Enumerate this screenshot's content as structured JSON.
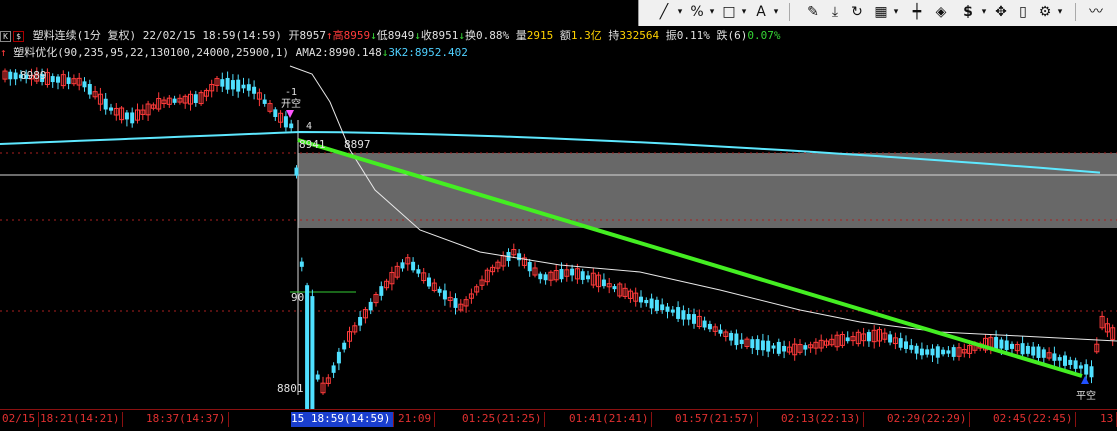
{
  "toolbar": {
    "tools": [
      "line-tool-icon",
      "percent-tool-icon",
      "rect-tool-icon",
      "text-tool-icon",
      "pencil-icon",
      "download-icon",
      "refresh-icon",
      "grid-icon",
      "candle-settings-icon",
      "diamond-icon",
      "dollar-icon",
      "move-icon",
      "bar-icon",
      "gear-icon",
      "line-chart-icon"
    ],
    "labels": {
      "percent": "%",
      "text": "A",
      "dollar": "$"
    }
  },
  "header": {
    "k_badge": "K",
    "s_badge": "$",
    "title": "塑料连续(1分 复权)",
    "datetime": "22/02/15 18:59(14:59)",
    "open": "开8957",
    "high": "高8959",
    "low": "低8949",
    "close": "收8951",
    "turnover": "换0.88%",
    "volume_label": "量",
    "volume": "2915",
    "amount_label": "额",
    "amount": "1.3亿",
    "hold_label": "持",
    "hold": "332564",
    "amplitude": "振0.11%",
    "change_label": "跌(6)",
    "change": "0.07%"
  },
  "indicator": {
    "name": "塑料优化(90,235,95,22,130100,24000,25900,1)",
    "ama2": "AMA2:8990.148",
    "k2": "3K2:8952.402"
  },
  "chart_data": {
    "type": "candlestick",
    "price_labels": [
      "8989",
      "8941",
      "8897",
      "8801",
      "90"
    ],
    "annotations": [
      "开空",
      "平空",
      "-1",
      "4"
    ],
    "time_labels": [
      "02/15",
      "18:21(14:21)",
      "18:37(14:37)",
      "15  18:59(14:59)",
      "21:09",
      "01:25(21:25)",
      "01:41(21:41)",
      "01:57(21:57)",
      "02:13(22:13)",
      "02:29(22:29)",
      "02:45(22:45)",
      "13"
    ],
    "selected_time_index": 3
  },
  "colors": {
    "up": "#ff3b3b",
    "down": "#4fe0ff",
    "trend": "#44ee22",
    "ma": "#5ee8ff",
    "zone": "#7a7a7a"
  }
}
